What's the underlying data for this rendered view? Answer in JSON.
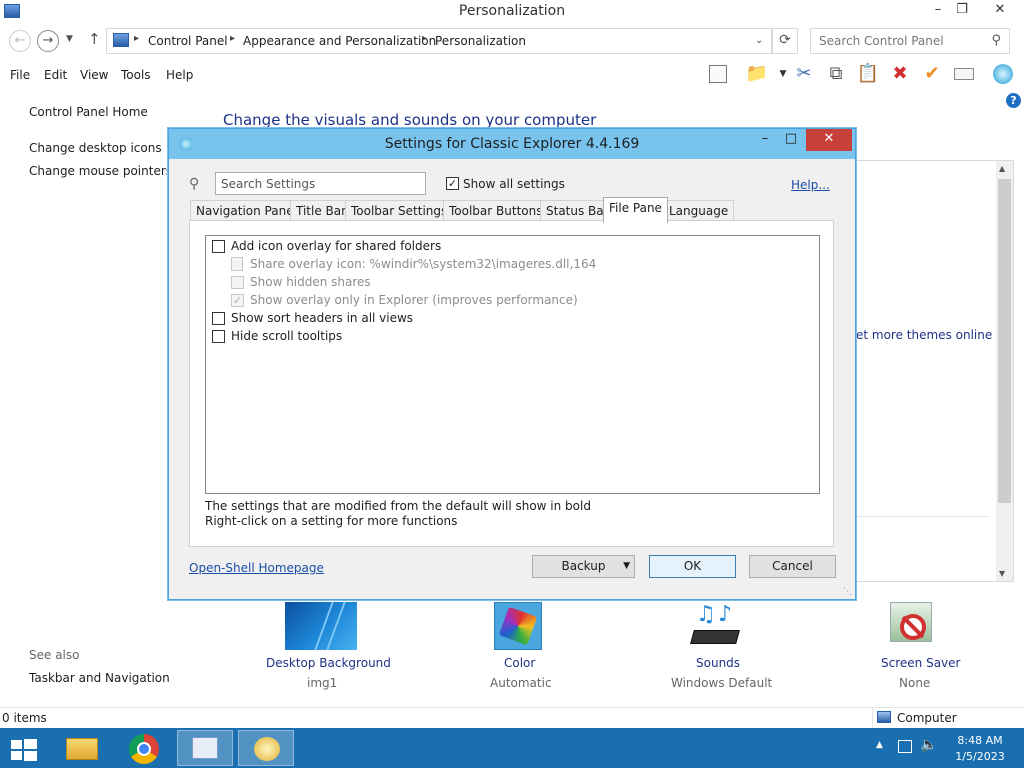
{
  "window": {
    "title": "Personalization"
  },
  "address": {
    "crumbs": [
      "Control Panel",
      "Appearance and Personalization",
      "Personalization"
    ],
    "search_placeholder": "Search Control Panel"
  },
  "menu": [
    "File",
    "Edit",
    "View",
    "Tools",
    "Help"
  ],
  "left_panel": {
    "home": "Control Panel Home",
    "links": [
      "Change desktop icons",
      "Change mouse pointers"
    ],
    "see_also_title": "See also",
    "see_also": [
      "Taskbar and Navigation"
    ]
  },
  "main": {
    "heading": "Change the visuals and sounds on your computer",
    "more_themes": "et more themes online"
  },
  "bottom_items": [
    {
      "label": "Desktop Background",
      "sub": "img1"
    },
    {
      "label": "Color",
      "sub": "Automatic"
    },
    {
      "label": "Sounds",
      "sub": "Windows Default"
    },
    {
      "label": "Screen Saver",
      "sub": "None"
    }
  ],
  "status": {
    "items": "0 items",
    "location": "Computer"
  },
  "taskbar": {
    "time": "8:48 AM",
    "date": "1/5/2023"
  },
  "dialog": {
    "title": "Settings for Classic Explorer 4.4.169",
    "search_placeholder": "Search Settings",
    "show_all_label": "Show all settings",
    "show_all_checked": true,
    "help_label": "Help...",
    "tabs": [
      "Navigation Pane",
      "Title Bar",
      "Toolbar Settings",
      "Toolbar Buttons",
      "Status Bar",
      "File Pane",
      "Language"
    ],
    "active_tab": "File Pane",
    "settings": [
      {
        "label": "Add icon overlay for shared folders",
        "checked": false,
        "enabled": true
      },
      {
        "label": "Share overlay icon: %windir%\\system32\\imageres.dll,164",
        "checked": false,
        "enabled": false
      },
      {
        "label": "Show hidden shares",
        "checked": false,
        "enabled": false
      },
      {
        "label": "Show overlay only in Explorer (improves performance)",
        "checked": true,
        "enabled": false
      },
      {
        "label": "Show sort headers in all views",
        "checked": false,
        "enabled": true
      },
      {
        "label": "Hide scroll tooltips",
        "checked": false,
        "enabled": true
      }
    ],
    "note1": "The settings that are modified from the default will show in bold",
    "note2": "Right-click on a setting for more functions",
    "homepage_link": "Open-Shell Homepage",
    "backup_label": "Backup",
    "ok_label": "OK",
    "cancel_label": "Cancel"
  }
}
